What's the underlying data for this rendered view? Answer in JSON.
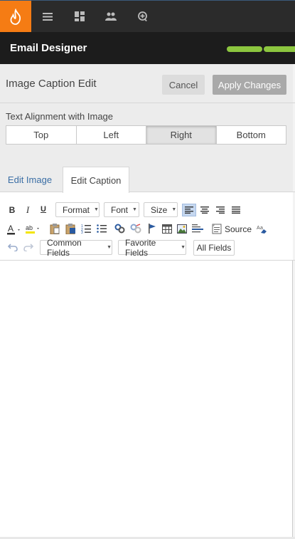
{
  "nav": {
    "logo_icon": "flame-icon",
    "items": [
      "menu-icon",
      "dashboard-icon",
      "people-icon",
      "add-circle-icon"
    ],
    "accent": "#f57c14"
  },
  "header": {
    "title": "Email Designer",
    "progress_color": "#8cc63f"
  },
  "panel": {
    "title": "Image Caption Edit",
    "cancel_label": "Cancel",
    "apply_label": "Apply Changes",
    "alignment_label": "Text Alignment with Image",
    "alignment_options": [
      "Top",
      "Left",
      "Right",
      "Bottom"
    ],
    "alignment_selected": "Right"
  },
  "tabs": {
    "edit_image": "Edit Image",
    "edit_caption": "Edit Caption",
    "active": "Edit Caption"
  },
  "toolbar": {
    "bold": "B",
    "italic": "I",
    "underline": "U",
    "format": "Format",
    "font": "Font",
    "size": "Size",
    "source": "Source",
    "common_fields": "Common Fields",
    "favorite_fields": "Favorite Fields",
    "all_fields": "All Fields"
  }
}
